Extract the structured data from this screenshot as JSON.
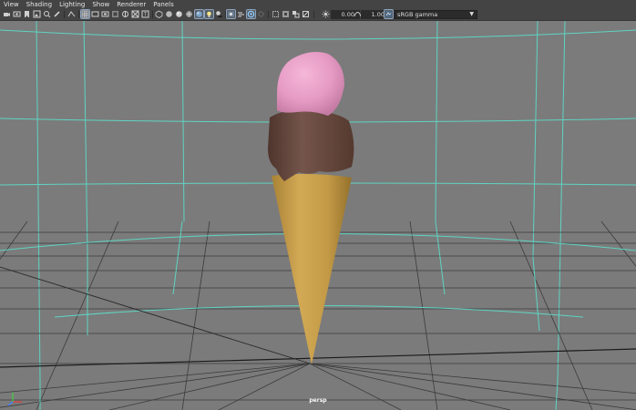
{
  "menu": {
    "items": [
      "View",
      "Shading",
      "Lighting",
      "Show",
      "Renderer",
      "Panels"
    ]
  },
  "toolbar": {
    "exposure_value": "0.00",
    "gamma_value": "1.00",
    "color_space": "sRGB gamma",
    "accent_color": "#8aa4c0"
  },
  "viewport": {
    "camera_name": "persp",
    "background_color": "#7b7b7b",
    "grid_color": "#5fd4c2"
  },
  "scene_object": {
    "name": "ice-cream-cone",
    "scoop_top_color": "#e59ac3",
    "scoop_chocolate_color": "#6a4a40",
    "cone_color": "#c49b48"
  }
}
